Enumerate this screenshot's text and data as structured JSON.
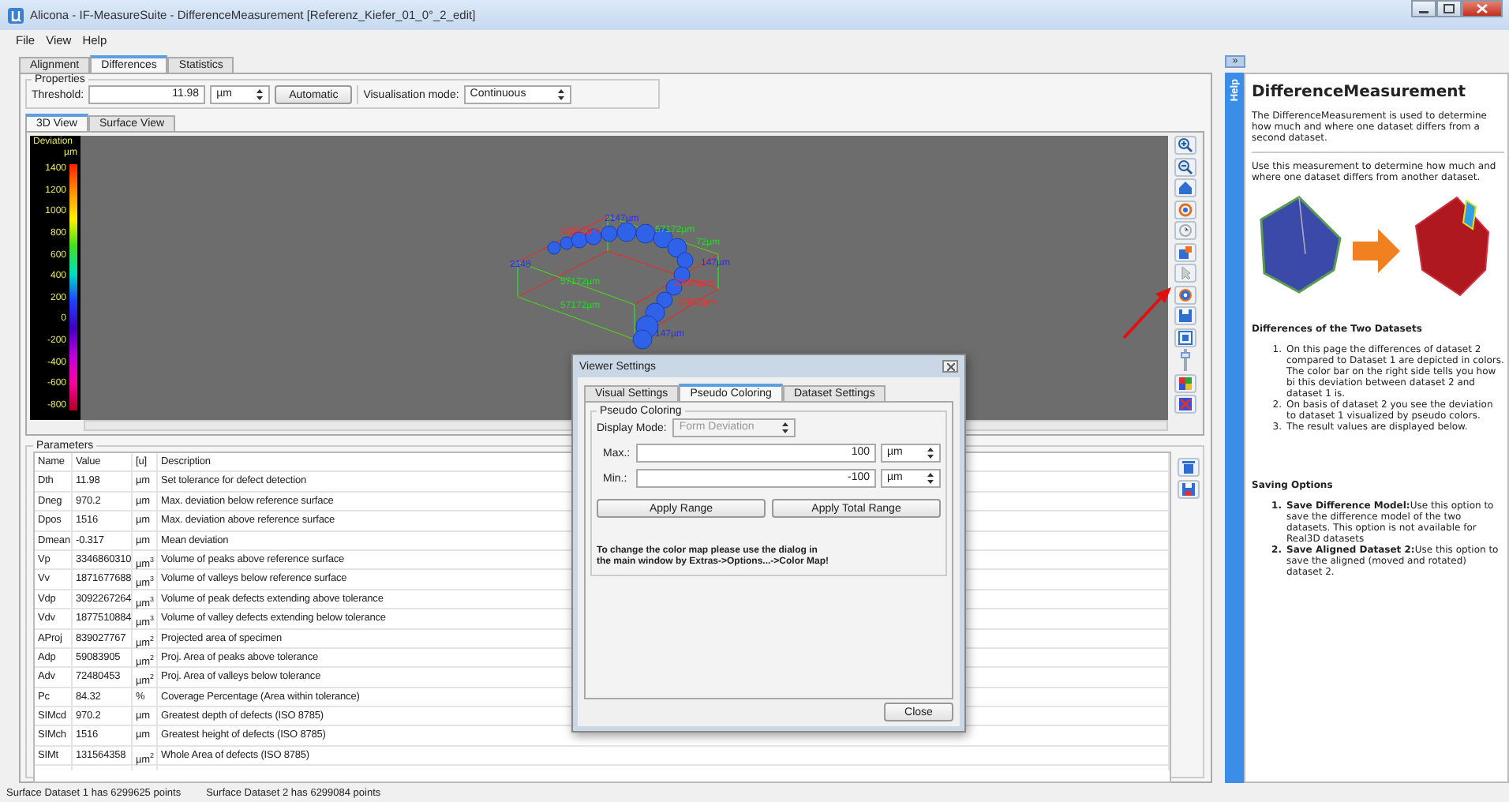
{
  "window": {
    "title": "Alicona - IF-MeasureSuite - DifferenceMeasurement  [Referenz_Kiefer_01_0°_2_edit]"
  },
  "menu": [
    "File",
    "View",
    "Help"
  ],
  "tabs": [
    {
      "label": "Alignment",
      "selected": false
    },
    {
      "label": "Differences",
      "selected": true
    },
    {
      "label": "Statistics",
      "selected": false
    }
  ],
  "properties": {
    "title": "Properties",
    "threshold_label": "Threshold:",
    "threshold_value": "11.98",
    "threshold_unit": "µm",
    "automatic_button": "Automatic",
    "mode_label": "Visualisation mode:",
    "mode_value": "Continuous"
  },
  "view_tabs": [
    {
      "label": "3D View",
      "selected": true
    },
    {
      "label": "Surface View",
      "selected": false
    }
  ],
  "colorbar": {
    "title": "Deviation",
    "unit": "µm",
    "ticks": [
      "1400",
      "1200",
      "1000",
      "800",
      "600",
      "400",
      "200",
      "0",
      "-200",
      "-400",
      "-600",
      "-800"
    ]
  },
  "model_labels": [
    {
      "text": "2147µm",
      "color": "#2a2aff"
    },
    {
      "text": "32092µm",
      "color": "#ff2a2a"
    },
    {
      "text": "57172µm",
      "color": "#22dd22"
    },
    {
      "text": "72µm",
      "color": "#22dd22"
    },
    {
      "text": "2148",
      "color": "#2a2aff"
    },
    {
      "text": "147µm",
      "color": "#2a2aff"
    },
    {
      "text": "57172µm",
      "color": "#22dd22"
    },
    {
      "text": "32092µm",
      "color": "#ff2a2a"
    },
    {
      "text": "57172µm",
      "color": "#22dd22"
    },
    {
      "text": "32092µm",
      "color": "#ff2a2a"
    },
    {
      "text": "147µm",
      "color": "#2a2aff"
    }
  ],
  "parameters": {
    "title": "Parameters",
    "columns": [
      "Name",
      "Value",
      "[u]",
      "Description"
    ],
    "rows": [
      [
        "Dth",
        "11.98",
        "µm",
        "Set tolerance for defect detection"
      ],
      [
        "Dneg",
        "970.2",
        "µm",
        "Max. deviation below reference surface"
      ],
      [
        "Dpos",
        "1516",
        "µm",
        "Max. deviation above reference surface"
      ],
      [
        "Dmean",
        "-0.317",
        "µm",
        "Mean deviation"
      ],
      [
        "Vp",
        "3346860310",
        "µm$^{3}$",
        "Volume of peaks above reference surface"
      ],
      [
        "Vv",
        "1871677688",
        "µm$^{3}$",
        "Volume of valleys below reference surface"
      ],
      [
        "Vdp",
        "3092267264",
        "µm$^{3}$",
        "Volume of peak defects extending above tolerance"
      ],
      [
        "Vdv",
        "1877510884",
        "µm$^{3}$",
        "Volume of valley defects extending below tolerance"
      ],
      [
        "AProj",
        "839027767",
        "µm$^{2}$",
        "Projected area of specimen"
      ],
      [
        "Adp",
        "59083905",
        "µm$^{2}$",
        "Proj. Area of peaks above tolerance"
      ],
      [
        "Adv",
        "72480453",
        "µm$^{2}$",
        "Proj. Area of valleys below tolerance"
      ],
      [
        "Pc",
        "84.32",
        "%",
        "Coverage Percentage (Area within tolerance)"
      ],
      [
        "SIMcd",
        "970.2",
        "µm",
        "Greatest depth of defects (ISO 8785)"
      ],
      [
        "SIMch",
        "1516",
        "µm",
        "Greatest height of defects  (ISO 8785)"
      ],
      [
        "SIMt",
        "131564358",
        "µm$^{2}$",
        "Whole Area of defects (ISO 8785)"
      ]
    ]
  },
  "status_bar": [
    "Surface Dataset 1 has 6299625 points",
    "Surface Dataset 2 has 6299084 points"
  ],
  "dialog": {
    "title": "Viewer Settings",
    "tabs": [
      {
        "label": "Visual Settings",
        "selected": false
      },
      {
        "label": "Pseudo Coloring",
        "selected": true
      },
      {
        "label": "Dataset Settings",
        "selected": false
      }
    ],
    "group_title": "Pseudo Coloring",
    "display_mode_label": "Display Mode:",
    "display_mode_value": "Form Deviation",
    "display_mode_disabled": true,
    "max_label": "Max.:",
    "max_value": "100",
    "max_unit": "µm",
    "min_label": "Min.:",
    "min_value": "-100",
    "min_unit": "µm",
    "buttons": [
      "Apply Range",
      "Apply Total Range"
    ],
    "note": "To change the color map please use the dialog in\nthe main window by Extras->Options...->Color Map!",
    "close_button": "Close"
  },
  "help": {
    "collapse": "»",
    "tab_label": "Help",
    "title": "DifferenceMeasurement",
    "intro": "The DifferenceMeasurement is used to determine how much and where one dataset differs from a second dataset.",
    "usage": "Use this measurement to determine how much and where one dataset differs from another dataset.",
    "section1": {
      "heading": "Differences of the Two Datasets",
      "items": [
        {
          "marker": "1.",
          "text": "On this page the differences of dataset 2 compared to Dataset 1 are depicted in colors. The color bar on the right side tells you how bi this deviation between dataset 2 and dataset 1 is."
        },
        {
          "marker": "2.",
          "text": "On basis of dataset 2 you see the deviation to dataset 1 visualized by pseudo colors."
        },
        {
          "marker": "3.",
          "text": "The result values are displayed below."
        }
      ]
    },
    "section2": {
      "heading": "Saving Options",
      "items": [
        {
          "marker": "1.",
          "text": "**Save Difference Model:**Use this option to save the difference model of the two datasets. This option is not available for Real3D datasets"
        },
        {
          "marker": "2.",
          "text": "**Save Aligned Dataset 2:**Use this option to save the aligned (moved and rotated) dataset 2."
        }
      ]
    }
  },
  "zoom_slider": {
    "level": 0.8
  }
}
